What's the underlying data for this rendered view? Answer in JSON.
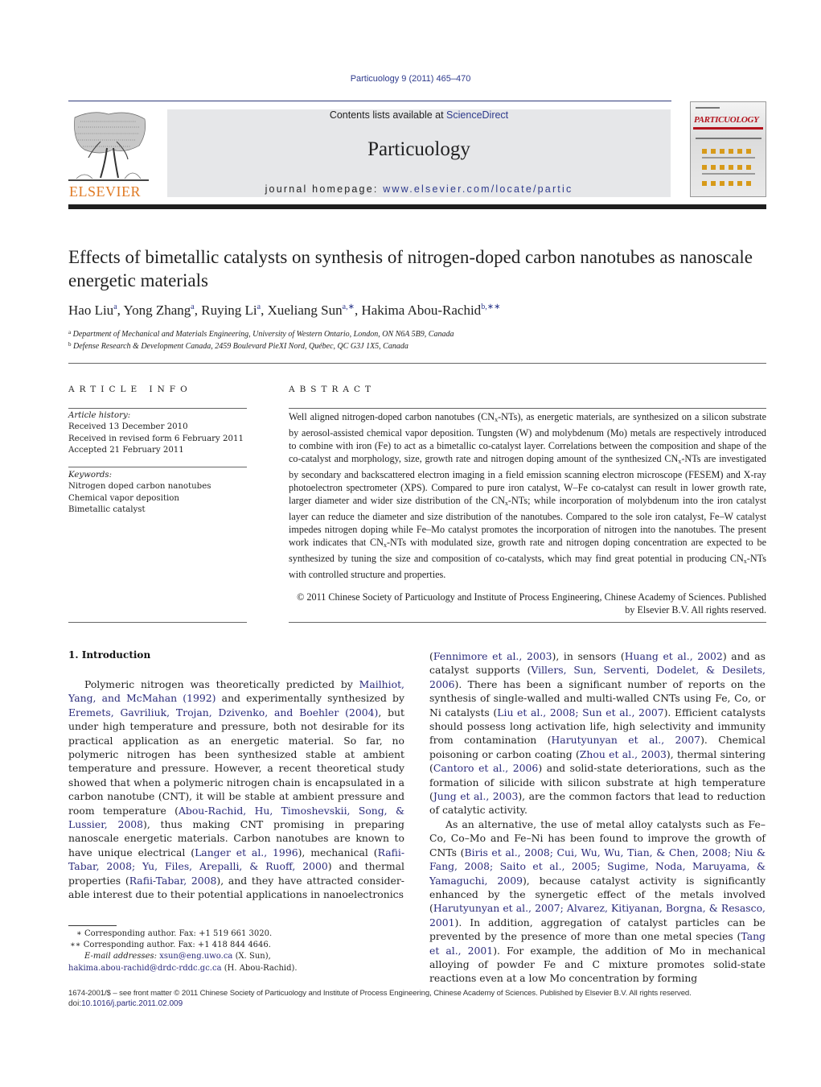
{
  "header": {
    "journal_ref": "Particuology 9 (2011) 465–470",
    "contents_prefix": "Contents lists available at ",
    "contents_link": "ScienceDirect",
    "journal_name": "Particuology",
    "homepage_prefix": "journal homepage: ",
    "homepage_link": "www.elsevier.com/locate/partic",
    "publisher_logo_text": "ELSEVIER",
    "cover_title": "PARTICUOLOGY"
  },
  "article": {
    "title": "Effects of bimetallic catalysts on synthesis of nitrogen-doped carbon nanotubes as nanoscale energetic materials",
    "authors": [
      {
        "name": "Hao Liu",
        "sup": "a"
      },
      {
        "name": "Yong Zhang",
        "sup": "a"
      },
      {
        "name": "Ruying Li",
        "sup": "a"
      },
      {
        "name": "Xueliang Sun",
        "sup": "a,∗"
      },
      {
        "name": "Hakima Abou-Rachid",
        "sup": "b,∗∗"
      }
    ],
    "affiliations": [
      {
        "key": "a",
        "text": "Department of Mechanical and Materials Engineering, University of Western Ontario, London, ON N6A 5B9, Canada"
      },
      {
        "key": "b",
        "text": "Defense Research & Development Canada, 2459 Boulevard PieXI Nord, Québec, QC G3J 1X5, Canada"
      }
    ]
  },
  "article_info": {
    "heading": "ARTICLE INFO",
    "history_label": "Article history:",
    "history": [
      "Received 13 December 2010",
      "Received in revised form 6 February 2011",
      "Accepted 21 February 2011"
    ],
    "keywords_label": "Keywords:",
    "keywords": [
      "Nitrogen doped carbon nanotubes",
      "Chemical vapor deposition",
      "Bimetallic catalyst"
    ]
  },
  "abstract": {
    "heading": "ABSTRACT",
    "segments": [
      "Well aligned nitrogen-doped carbon nanotubes (CN",
      "-NTs), as energetic materials, are synthesized on a silicon substrate by aerosol-assisted chemical vapor deposition. Tungsten (W) and molybdenum (Mo) metals are respectively introduced to combine with iron (Fe) to act as a bimetallic co-catalyst layer. Cor­relations between the composition and shape of the co-catalyst and morphology, size, growth rate and nitrogen doping amount of the synthesized CN",
      "-NTs are investigated by secondary and backscattered electron imaging in a field emission scanning electron microscope (FESEM) and X-ray photoelectron spectrometer (XPS). Compared to pure iron catalyst, W–Fe co-catalyst can result in lower growth rate, larger diameter and wider size distribution of the CN",
      "-NTs; while incorporation of molybdenum into the iron catalyst layer can reduce the diameter and size distribution of the nanotubes. Compared to the sole iron catalyst, Fe–W catalyst impedes nitrogen doping while Fe–Mo catalyst promotes the incorporation of nitrogen into the nanotubes. The present work indicates that CN",
      "-NTs with modulated size, growth rate and nitrogen doping concentration are expected to be synthesized by tuning the size and composi­tion of co-catalysts, which may find great potential in producing CN",
      "-NTs with controlled structure and properties."
    ],
    "subscript": "x",
    "copyright": "© 2011 Chinese Society of Particuology and Institute of Process Engineering, Chinese Academy of Sciences. Published by Elsevier B.V. All rights reserved."
  },
  "introduction": {
    "heading": "1.  Introduction",
    "left_column": [
      {
        "t": "Polymeric nitrogen was theoretically predicted by "
      },
      {
        "t": "Mailhiot, Yang, and McMahan (1992)",
        "link": true
      },
      {
        "t": " and experimentally synthesized by "
      },
      {
        "t": "Eremets, Gavriliuk, Trojan, Dzivenko, and Boehler (2004)",
        "link": true
      },
      {
        "t": ", but under high temperature and pressure, both not desirable for its practical application as an energetic material. So far, no polymeric nitrogen has been synthesized stable at ambient temperature and pressure. However, a recent theoretical study showed that when a polymeric nitrogen chain is encapsulated in a carbon nanotube (CNT), it will be stable at ambient pressure and room temperature ("
      },
      {
        "t": "Abou-Rachid, Hu, Timoshevskii, Song, & Lussier, 2008",
        "link": true
      },
      {
        "t": "), thus making CNT promis­ing in preparing nanoscale energetic materials. Carbon nanotubes are known to have unique electrical ("
      },
      {
        "t": "Langer et al., 1996",
        "link": true
      },
      {
        "t": "), mechani­cal ("
      },
      {
        "t": "Rafii-Tabar, 2008; Yu, Files, Arepalli, & Ruoff, 2000",
        "link": true
      },
      {
        "t": ") and thermal properties ("
      },
      {
        "t": "Rafii-Tabar, 2008",
        "link": true
      },
      {
        "t": "), and they have attracted consider­able interest due to their potential applications in nanoelectronics"
      }
    ],
    "right_column_p1": [
      {
        "t": "("
      },
      {
        "t": "Fennimore et al., 2003",
        "link": true
      },
      {
        "t": "), in sensors ("
      },
      {
        "t": "Huang et al., 2002",
        "link": true
      },
      {
        "t": ") and as cat­alyst supports ("
      },
      {
        "t": "Villers, Sun, Serventi, Dodelet, & Desilets, 2006",
        "link": true
      },
      {
        "t": "). There has been a significant number of reports on the synthesis of single-walled and multi-walled CNTs using Fe, Co, or Ni cata­lysts ("
      },
      {
        "t": "Liu et al., 2008; Sun et al., 2007",
        "link": true
      },
      {
        "t": "). Efficient catalysts should possess long activation life, high selectivity and immunity from contamination ("
      },
      {
        "t": "Harutyunyan et al., 2007",
        "link": true
      },
      {
        "t": "). Chemical poisoning or carbon coating ("
      },
      {
        "t": "Zhou et al., 2003",
        "link": true
      },
      {
        "t": "), thermal sintering ("
      },
      {
        "t": "Cantoro et al., 2006",
        "link": true
      },
      {
        "t": ") and solid-state deteriorations, such as the formation of sili­cide with silicon substrate at high temperature ("
      },
      {
        "t": "Jung et al., 2003",
        "link": true
      },
      {
        "t": "), are the common factors that lead to reduction of catalytic activ­ity."
      }
    ],
    "right_column_p2": [
      {
        "t": "As an alternative, the use of metal alloy catalysts such as Fe–Co, Co–Mo and Fe–Ni has been found to improve the growth of CNTs ("
      },
      {
        "t": "Biris et al., 2008; Cui, Wu, Wu, Tian, & Chen, 2008; Niu & Fang, 2008; Saito et al., 2005; Sugime, Noda, Maruyama, & Yamaguchi, 2009",
        "link": true
      },
      {
        "t": "), because catalyst activity is significantly enhanced by the synergetic effect of the metals involved ("
      },
      {
        "t": "Harutyunyan et al., 2007; Alvarez, Kitiyanan, Borgna, & Resasco, 2001",
        "link": true
      },
      {
        "t": "). In addition, aggrega­tion of catalyst particles can be prevented by the presence of more than one metal species ("
      },
      {
        "t": "Tang et al., 2001",
        "link": true
      },
      {
        "t": "). For example, the addition of Mo in mechanical alloying of powder Fe and C mixture promotes solid-state reactions even at a low Mo concentration by forming"
      }
    ]
  },
  "footnotes": {
    "fn1": "∗  Corresponding author. Fax: +1 519 661 3020.",
    "fn2": "∗∗  Corresponding author. Fax: +1 418 844 4646.",
    "email_label": "E-mail addresses: ",
    "email1": "xsun@eng.uwo.ca",
    "email1_owner": " (X. Sun),",
    "email2": "hakima.abou-rachid@drdc-rddc.gc.ca",
    "email2_owner": " (H. Abou-Rachid)."
  },
  "footer": {
    "front_matter": "1674-2001/$ – see front matter © 2011 Chinese Society of Particuology and Institute of Process Engineering, Chinese Academy of Sciences. Published by Elsevier B.V. All rights reserved.",
    "doi_prefix": "doi:",
    "doi": "10.1016/j.partic.2011.02.009"
  },
  "colors": {
    "link": "#2a2a7a",
    "elsevier_orange": "#e07a24",
    "masthead_bg": "#e6e7e9",
    "cover_red": "#b3121c"
  }
}
